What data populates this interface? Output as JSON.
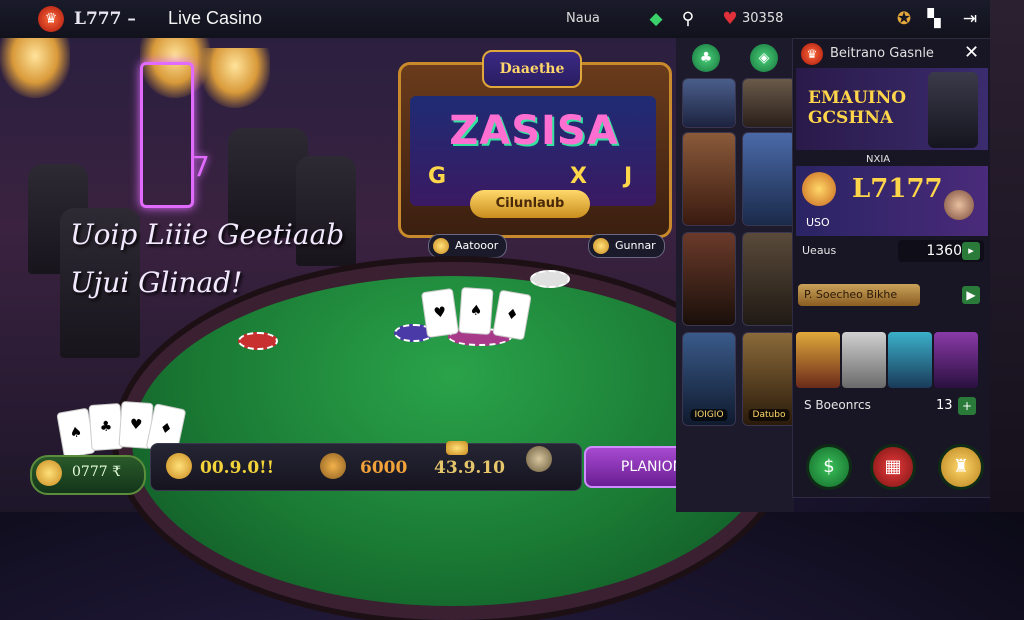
{
  "topbar": {
    "brand": "L777 –",
    "title": "Live Casino",
    "nav_name": "Naua",
    "coins": "30358",
    "icons": [
      "brand-logo-icon",
      "gift-icon",
      "search-icon",
      "hearts-icon",
      "badge-icon",
      "chat-icon",
      "exit-icon"
    ]
  },
  "scene": {
    "slot_header": "Daaethe",
    "slot_title": "ZASISA",
    "slot_reel_glyphs": [
      "G",
      "X",
      "J"
    ],
    "slot_sub": "Cilunlaub",
    "pill_left": "Aatooor",
    "pill_right": "Gunnar",
    "promo_line1": "Uoip Liiie Geetiaab",
    "promo_line2": "Ujui Glinad!",
    "neon_glyph": "7"
  },
  "bottom": {
    "balance": "0777 ₹",
    "stats": [
      {
        "value": "00.9.0!!",
        "color": "#f2d33a"
      },
      {
        "value": "6000",
        "color": "#f2a23a"
      },
      {
        "value": "43.9.10",
        "color": "#e6c66a"
      }
    ],
    "play_label": "PLANION",
    "round_icon": "check-icon"
  },
  "dealers": {
    "tiles": [
      {
        "badge": ""
      },
      {
        "badge": ""
      },
      {
        "badge": ""
      },
      {
        "badge": ""
      },
      {
        "badge": ""
      },
      {
        "badge": ""
      },
      {
        "badge": "IOIGIO"
      },
      {
        "badge": "Datubo"
      }
    ]
  },
  "panel": {
    "title": "Beitrano Gasnle",
    "close": "✕",
    "banner_line1": "EMAUINO",
    "banner_line2": "GCSHNA",
    "label_small": "NXIA",
    "promo_code": "L7177",
    "promo_mini": "USO",
    "row_label": "Ueaus",
    "amount": "1360",
    "promo_button": "P. Soecheo Bikhe",
    "games_label": "S Boeonrcs",
    "games_count": "13"
  },
  "colors": {
    "accent_green": "#2aa34a",
    "accent_purple": "#a74ad0",
    "gold": "#ffd54a"
  }
}
